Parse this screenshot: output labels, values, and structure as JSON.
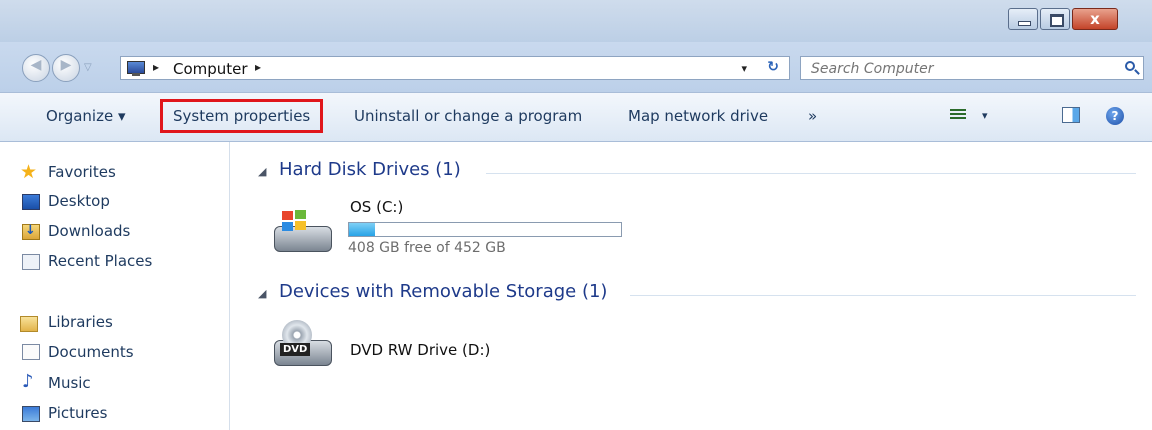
{
  "window": {
    "caption_buttons": {
      "minimize": "minimize",
      "maximize": "maximize",
      "close": "x"
    }
  },
  "navigation": {
    "back_icon": "back-arrow-icon",
    "forward_icon": "forward-arrow-icon",
    "address": {
      "crumbs": [
        "Computer"
      ],
      "separator": "▸",
      "dropdown_glyph": "▾",
      "refresh_glyph": "↻"
    },
    "search": {
      "placeholder": "Search Computer"
    }
  },
  "toolbar": {
    "organize_label": "Organize ▾",
    "system_properties_label": "System properties",
    "uninstall_label": "Uninstall or change a program",
    "map_drive_label": "Map network drive",
    "more_label": "»",
    "views_dropdown": "▾",
    "help_glyph": "?",
    "highlight_color": "#e0161b"
  },
  "nav_pane": {
    "favorites": [
      "Favorites",
      "Desktop",
      "Downloads",
      "Recent Places"
    ],
    "libraries": [
      "Libraries",
      "Documents",
      "Music",
      "Pictures"
    ]
  },
  "content": {
    "groups": [
      {
        "title": "Hard Disk Drives (1)",
        "drives": [
          {
            "name": "OS (C:)",
            "free_text": "408 GB free of 452 GB",
            "used_fraction": 0.097
          }
        ]
      },
      {
        "title": "Devices with Removable Storage (1)",
        "drives": [
          {
            "name": "DVD RW Drive (D:)",
            "badge": "DVD"
          }
        ]
      }
    ],
    "collapse_glyph": "◢"
  }
}
